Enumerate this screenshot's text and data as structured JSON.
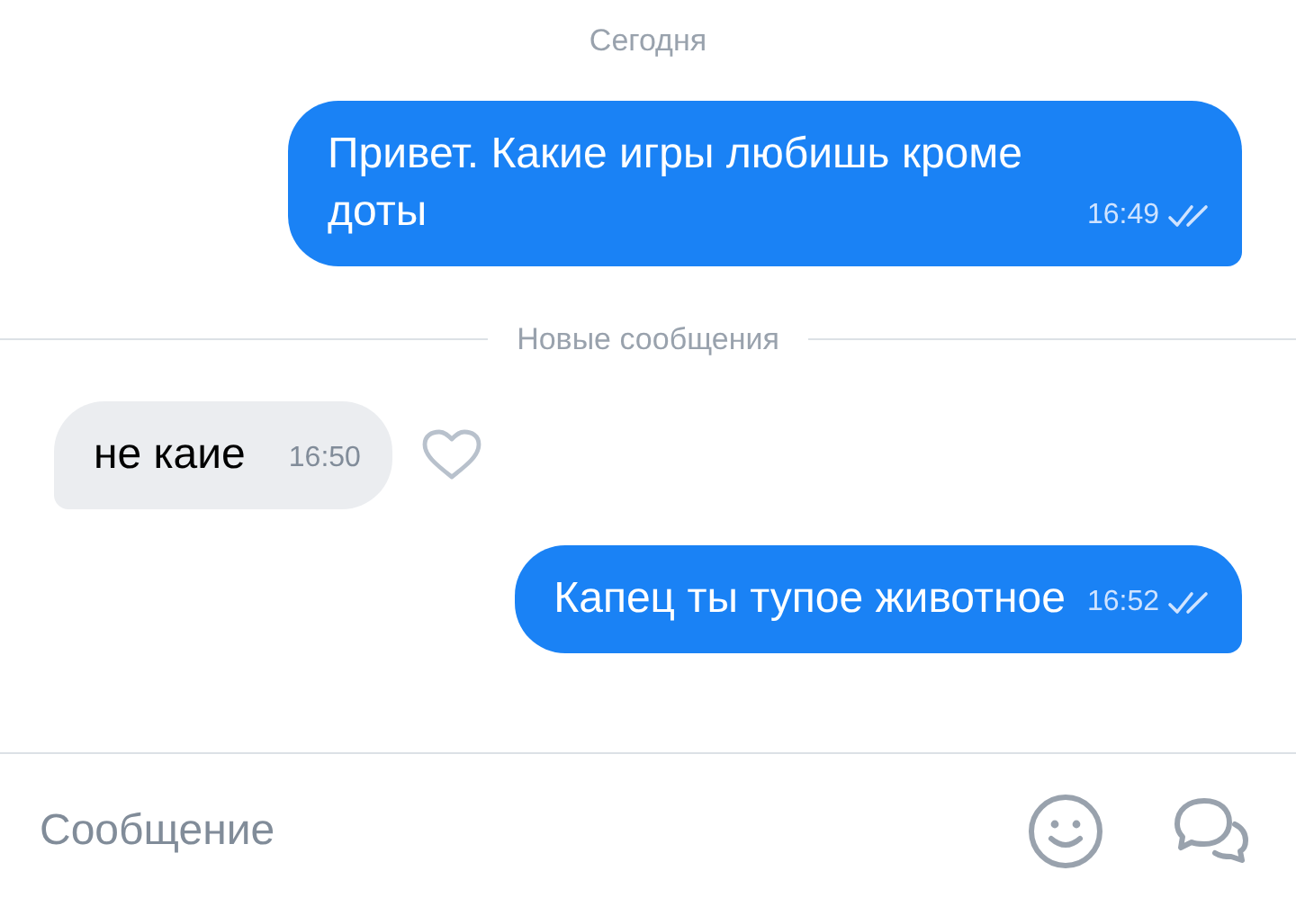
{
  "date_label": "Сегодня",
  "messages": [
    {
      "kind": "outgoing",
      "text": "Привет. Какие игры любишь кроме доты",
      "time": "16:49",
      "read": true
    },
    {
      "kind": "divider",
      "text": "Новые сообщения"
    },
    {
      "kind": "incoming",
      "text": "не каие",
      "time": "16:50",
      "liked": false
    },
    {
      "kind": "outgoing",
      "text": "Капец ты тупое животное",
      "time": "16:52",
      "read": true
    }
  ],
  "composer": {
    "placeholder": "Сообщение"
  }
}
